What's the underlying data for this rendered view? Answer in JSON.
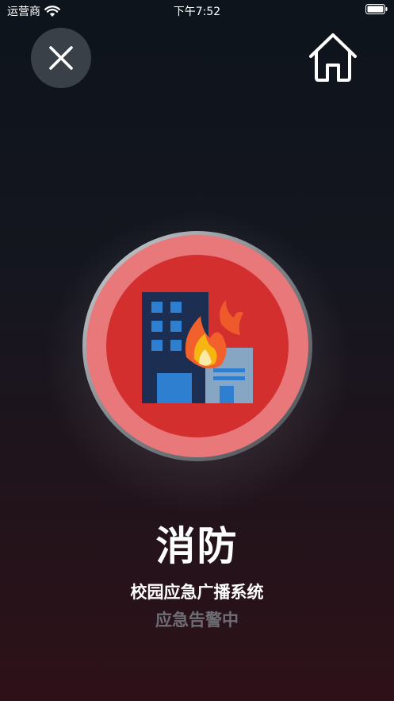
{
  "status_bar": {
    "carrier": "运营商",
    "time": "下午7:52",
    "icons": [
      "wifi-icon",
      "battery-icon"
    ]
  },
  "header": {
    "close_icon": "close-icon",
    "home_icon": "home-icon"
  },
  "alert": {
    "icon": "building-fire-icon",
    "title": "消防",
    "subtitle": "校园应急广播系统",
    "status": "应急告警中"
  },
  "colors": {
    "badge_outer": "#e8787a",
    "badge_inner": "#d42f2f",
    "ring": "#9aa0a6",
    "close_bg": "#3a4048",
    "status_text": "#6e6e74"
  }
}
